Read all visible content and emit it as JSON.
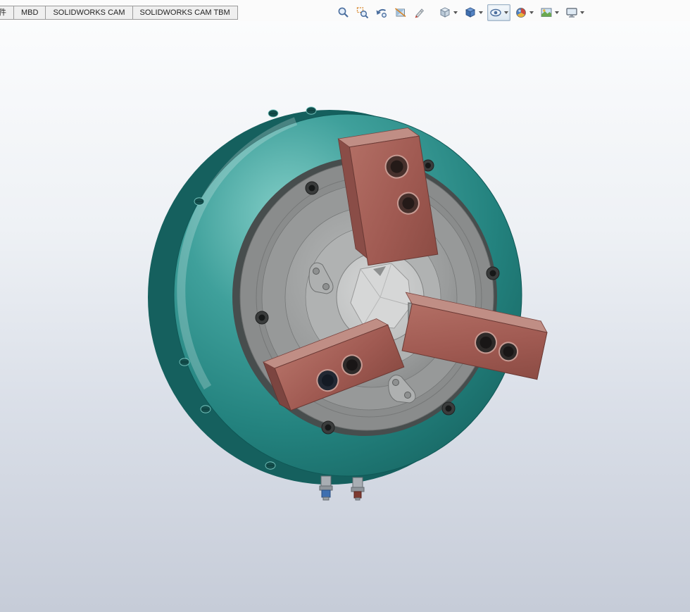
{
  "tabs": [
    {
      "label": "件"
    },
    {
      "label": "MBD"
    },
    {
      "label": "SOLIDWORKS CAM"
    },
    {
      "label": "SOLIDWORKS CAM TBM"
    }
  ],
  "heads_up_toolbar": {
    "buttons": [
      {
        "name": "zoom-to-fit",
        "has_dropdown": false,
        "pressed": false
      },
      {
        "name": "zoom-to-area",
        "has_dropdown": false,
        "pressed": false
      },
      {
        "name": "previous-view",
        "has_dropdown": false,
        "pressed": false
      },
      {
        "name": "section-view",
        "has_dropdown": false,
        "pressed": false
      },
      {
        "name": "dynamic-annotation-views",
        "has_dropdown": false,
        "pressed": false
      },
      {
        "name": "view-orientation",
        "has_dropdown": true,
        "pressed": false
      },
      {
        "name": "display-style",
        "has_dropdown": true,
        "pressed": false
      },
      {
        "name": "hide-show-items",
        "has_dropdown": true,
        "pressed": true
      },
      {
        "name": "edit-appearance",
        "has_dropdown": true,
        "pressed": false
      },
      {
        "name": "apply-scene",
        "has_dropdown": true,
        "pressed": false
      },
      {
        "name": "view-settings",
        "has_dropdown": true,
        "pressed": false
      }
    ]
  },
  "viewport": {
    "model_name": "three-jaw-lathe-chuck",
    "jaw_count": 3,
    "colors": {
      "body_teal": "#33948F",
      "body_teal_light": "#84CFC8",
      "body_teal_dark": "#176562",
      "body_teal_side": "#135957",
      "face_gray_outer": "#8A8C8C",
      "face_gray_inner": "#A9ABAB",
      "hub_gray": "#C2C4C4",
      "center_hole_gray": "#D5D6D6",
      "jaw_red": "#A4635C",
      "jaw_red_top": "#C08E85",
      "jaw_red_side": "#7C4540",
      "hole_dark": "#2E2A29",
      "fitting_left_tip": "#3E6FB0",
      "fitting_right_tip": "#7E3A30",
      "background_top": "#FBFCFD",
      "background_bottom": "#C6CCD8"
    }
  }
}
